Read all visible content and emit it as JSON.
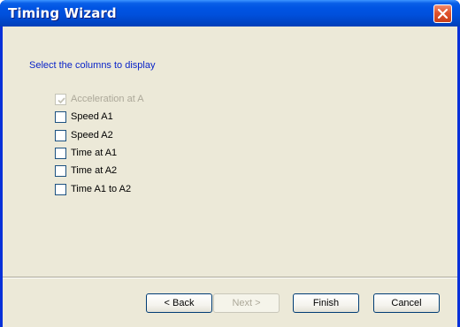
{
  "window": {
    "title": "Timing Wizard",
    "close_icon": "close-icon"
  },
  "content": {
    "heading": "Select the columns to display",
    "options": [
      {
        "label": "Acceleration at A",
        "checked": true,
        "disabled": true
      },
      {
        "label": "Speed A1",
        "checked": false,
        "disabled": false
      },
      {
        "label": "Speed A2",
        "checked": false,
        "disabled": false
      },
      {
        "label": "Time at A1",
        "checked": false,
        "disabled": false
      },
      {
        "label": "Time at A2",
        "checked": false,
        "disabled": false
      },
      {
        "label": "Time A1 to A2",
        "checked": false,
        "disabled": false
      }
    ]
  },
  "buttons": {
    "back": "< Back",
    "next": "Next >",
    "finish": "Finish",
    "cancel": "Cancel"
  },
  "colors": {
    "titlebar": "#0054e3",
    "dialog_bg": "#ece9d8",
    "heading_text": "#0a24c8",
    "close_button": "#e0532d"
  }
}
